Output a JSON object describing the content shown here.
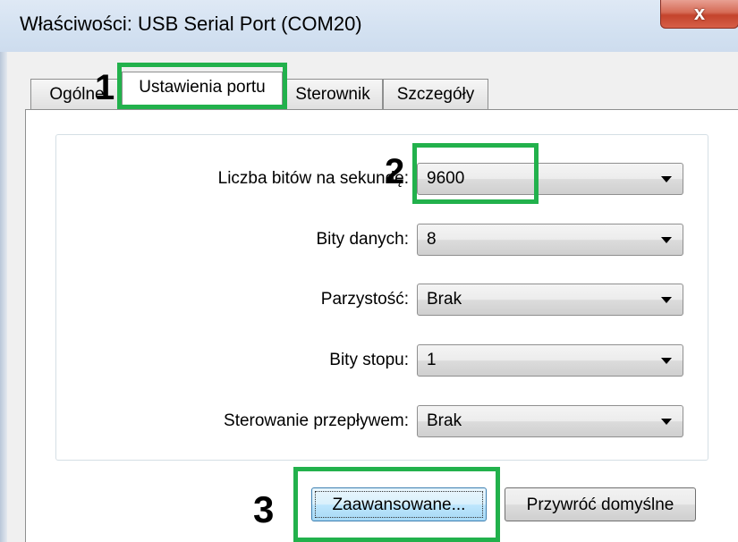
{
  "window": {
    "title": "Właściwości: USB Serial Port (COM20)",
    "close_glyph": "x"
  },
  "tabs": [
    {
      "label": "Ogólne",
      "active": false
    },
    {
      "label": "Ustawienia portu",
      "active": true
    },
    {
      "label": "Sterownik",
      "active": false
    },
    {
      "label": "Szczegóły",
      "active": false
    }
  ],
  "settings": {
    "baud": {
      "label": "Liczba bitów na sekundę:",
      "value": "9600"
    },
    "data_bits": {
      "label": "Bity danych:",
      "value": "8"
    },
    "parity": {
      "label": "Parzystość:",
      "value": "Brak"
    },
    "stop_bits": {
      "label": "Bity stopu:",
      "value": "1"
    },
    "flow_control": {
      "label": "Sterowanie przepływem:",
      "value": "Brak"
    }
  },
  "buttons": {
    "advanced": "Zaawansowane...",
    "restore_defaults": "Przywróć domyślne"
  },
  "annotations": {
    "color": "#22b14c",
    "markers": [
      "1",
      "2",
      "3"
    ]
  },
  "icons": {
    "dropdown": "chevron-down-icon",
    "close": "close-icon"
  }
}
